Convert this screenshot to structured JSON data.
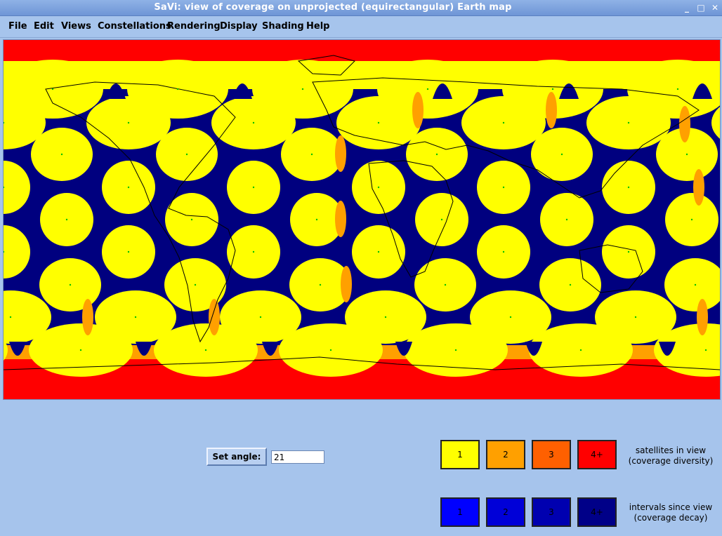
{
  "window": {
    "title": "SaVi: view of coverage on unprojected (equirectangular) Earth map",
    "controls": {
      "minimize": "_",
      "maximize": "□",
      "close": "✕"
    }
  },
  "menu": [
    "File",
    "Edit",
    "Views",
    "Constellations",
    "Rendering",
    "Display",
    "Shading",
    "Help"
  ],
  "map": {
    "colors": {
      "background": "#00007f",
      "coverage_1": "#ffff00",
      "coverage_2": "#ffa000",
      "coverage_3": "#ff6000",
      "coverage_4plus": "#ff0000",
      "subsatellite_point": "#00c000",
      "coastline": "#000000"
    }
  },
  "controls": {
    "set_angle_label": "Set angle:",
    "angle_value": "21"
  },
  "legend": {
    "diversity": {
      "swatches": [
        {
          "label": "1",
          "color": "#ffff00"
        },
        {
          "label": "2",
          "color": "#ffa000"
        },
        {
          "label": "3",
          "color": "#ff6000"
        },
        {
          "label": "4+",
          "color": "#ff0000"
        }
      ],
      "line1": "satellites in view",
      "line2": "(coverage diversity)"
    },
    "decay": {
      "swatches": [
        {
          "label": "1",
          "color": "#0000ff"
        },
        {
          "label": "2",
          "color": "#0000d8"
        },
        {
          "label": "3",
          "color": "#0000b0"
        },
        {
          "label": "4+",
          "color": "#000088"
        }
      ],
      "line1": "intervals since view",
      "line2": "(coverage decay)"
    }
  }
}
